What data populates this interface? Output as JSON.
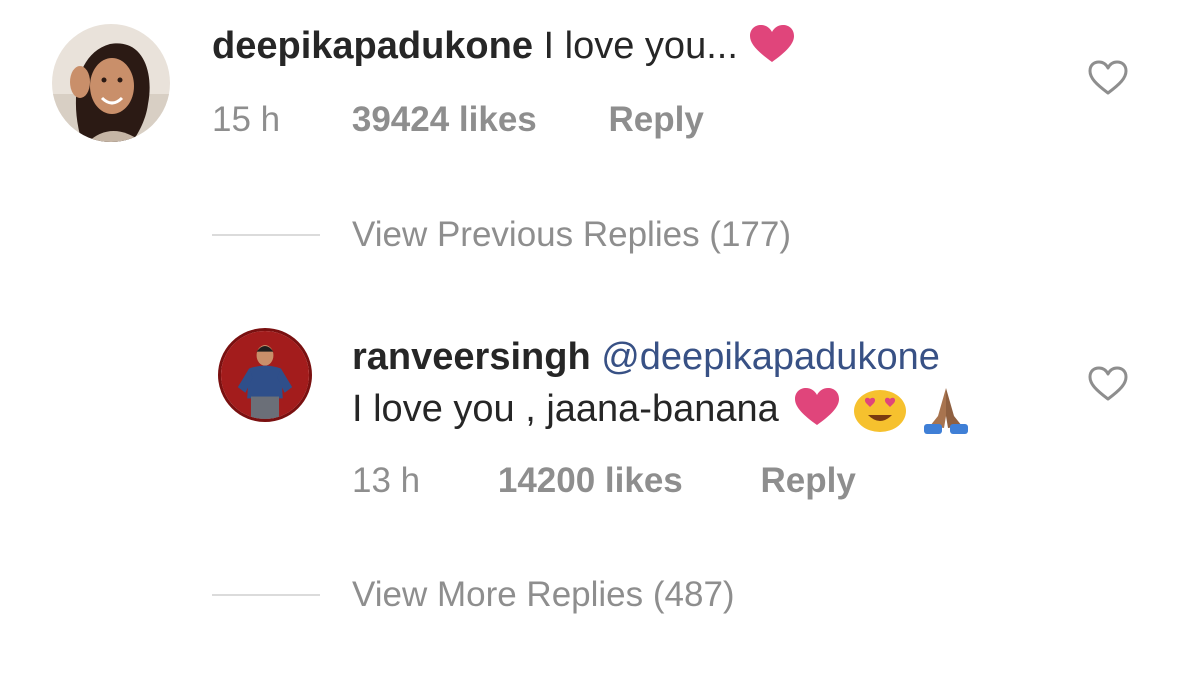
{
  "comment": {
    "username": "deepikapadukone",
    "text": "I love you...",
    "text_emoji": "heart-emoji",
    "time": "15 h",
    "likes": "39424 likes",
    "reply_label": "Reply",
    "like_icon": "heart-outline-icon"
  },
  "previous_replies": {
    "label": "View Previous Replies (177)"
  },
  "reply": {
    "username": "ranveersingh",
    "mention": "@deepikapadukone",
    "text": "I love you , jaana-banana",
    "text_emojis": [
      "heart-emoji",
      "heart-eyes-emoji",
      "folded-hands-emoji"
    ],
    "time": "13 h",
    "likes": "14200 likes",
    "reply_label": "Reply",
    "like_icon": "heart-outline-icon"
  },
  "more_replies": {
    "label": "View More Replies (487)"
  },
  "colors": {
    "text": "#262626",
    "muted": "#8e8e8e",
    "mention": "#385185",
    "heart_emoji": "#e0457b",
    "divider": "#dbdbdb"
  }
}
